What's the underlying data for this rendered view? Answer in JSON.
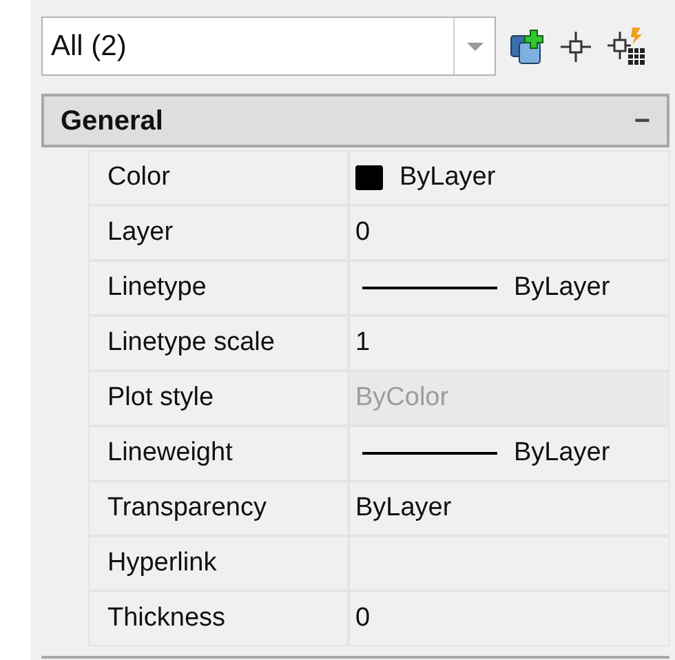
{
  "selector": {
    "value": "All (2)"
  },
  "section": {
    "title": "General",
    "collapse_symbol": "−",
    "expanded": true
  },
  "properties": [
    {
      "label": "Color",
      "kind": "swatch",
      "color": "#000000",
      "value": "ByLayer",
      "disabled": false
    },
    {
      "label": "Layer",
      "kind": "text",
      "value": "0",
      "disabled": false
    },
    {
      "label": "Linetype",
      "kind": "line",
      "value": "ByLayer",
      "disabled": false
    },
    {
      "label": "Linetype scale",
      "kind": "text",
      "value": "1",
      "disabled": false
    },
    {
      "label": "Plot style",
      "kind": "text",
      "value": "ByColor",
      "disabled": true
    },
    {
      "label": "Lineweight",
      "kind": "line",
      "value": "ByLayer",
      "disabled": false
    },
    {
      "label": "Transparency",
      "kind": "text",
      "value": "ByLayer",
      "disabled": false
    },
    {
      "label": "Hyperlink",
      "kind": "empty",
      "disabled": false
    },
    {
      "label": "Thickness",
      "kind": "text",
      "value": "0",
      "disabled": false
    }
  ]
}
